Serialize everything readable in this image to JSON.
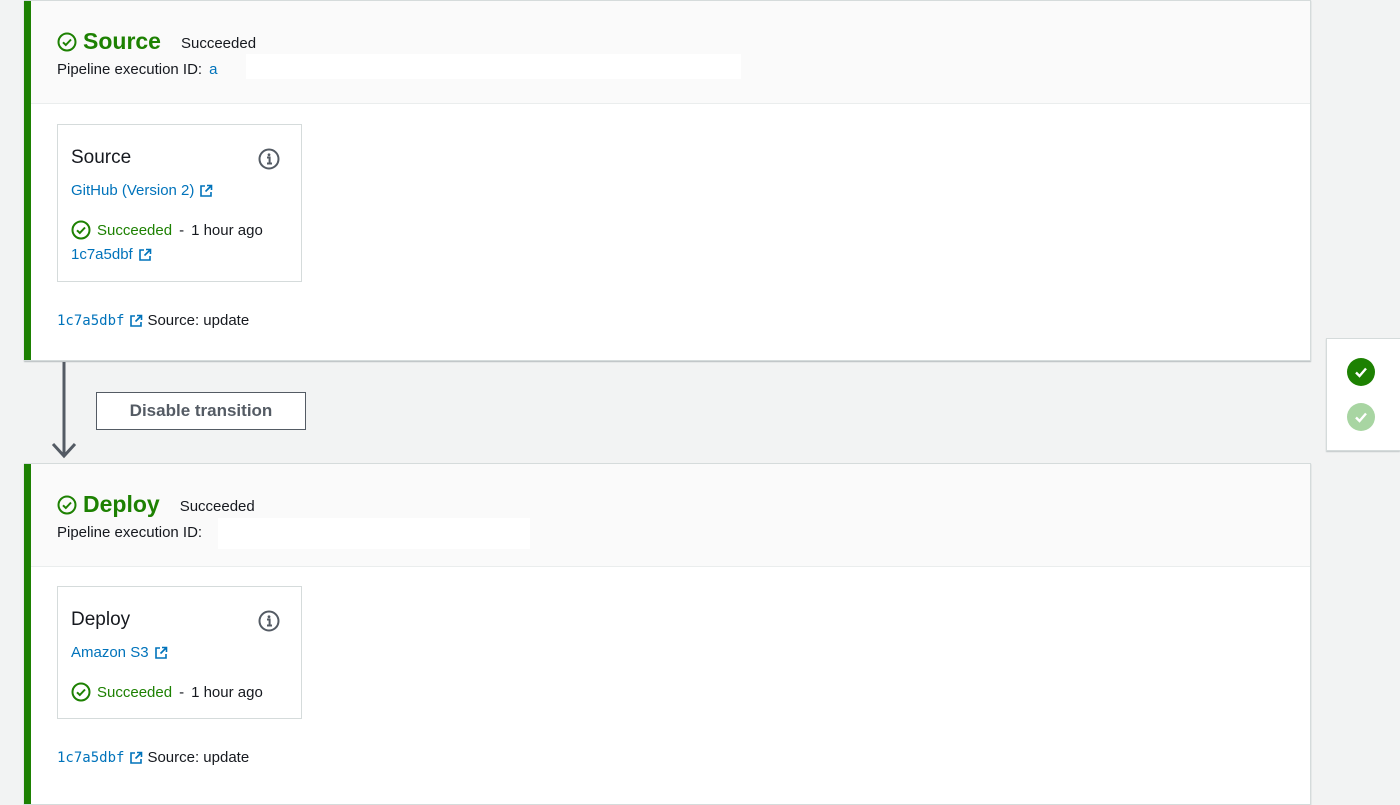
{
  "stages": [
    {
      "name": "Source",
      "status": "Succeeded",
      "execution_label": "Pipeline execution ID:",
      "execution_id": "a",
      "action": {
        "name": "Source",
        "provider": "GitHub (Version 2)",
        "status": "Succeeded",
        "separator": "-",
        "time": "1 hour ago",
        "commit": "1c7a5dbf"
      },
      "footer": {
        "commit": "1c7a5dbf",
        "message": "Source: update"
      }
    },
    {
      "name": "Deploy",
      "status": "Succeeded",
      "execution_label": "Pipeline execution ID:",
      "execution_id": "",
      "action": {
        "name": "Deploy",
        "provider": "Amazon S3",
        "status": "Succeeded",
        "separator": "-",
        "time": "1 hour ago"
      },
      "footer": {
        "commit": "1c7a5dbf",
        "message": "Source: update"
      }
    }
  ],
  "transition": {
    "button_label": "Disable transition"
  },
  "colors": {
    "success": "#1d8102",
    "success_light": "#a8d5a2",
    "link": "#0073bb",
    "border": "#d5dbdb"
  },
  "icons": [
    "check-circle-icon",
    "info-icon",
    "external-link-icon",
    "arrow-down-icon",
    "check-filled-icon"
  ]
}
